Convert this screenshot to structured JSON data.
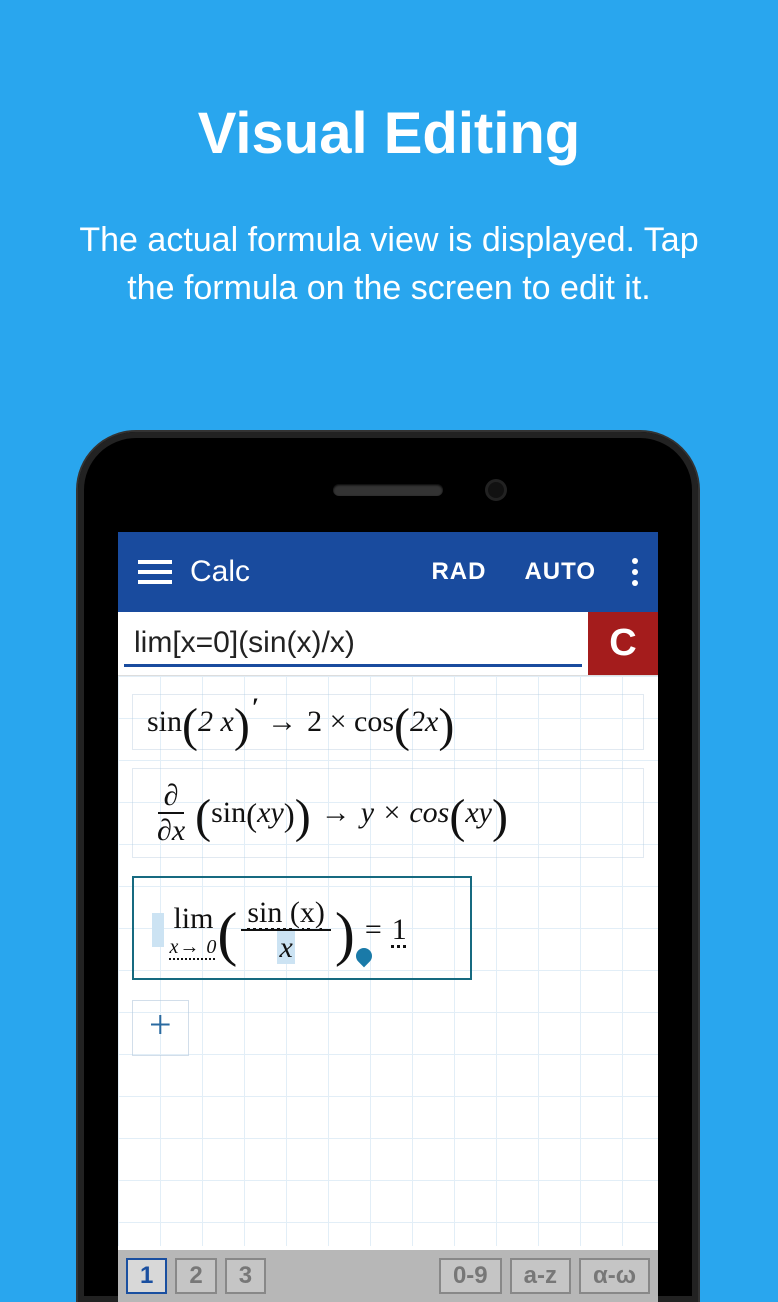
{
  "promo": {
    "title": "Visual Editing",
    "subtitle": "The actual formula view is displayed. Tap the formula on the screen to edit it."
  },
  "appbar": {
    "title": "Calc",
    "angle_mode": "RAD",
    "auto_mode": "AUTO"
  },
  "input": {
    "expression": "lim[x=0](sin(x)/x)",
    "clear_label": "C"
  },
  "formulas": {
    "f1_lhs_prefix": "sin",
    "f1_lhs_inner": "2 x",
    "f1_rhs": "2 × cos",
    "f1_rhs_inner": "2x",
    "f2_d_top": "∂",
    "f2_d_bot": "∂x",
    "f2_lhs": "sin",
    "f2_lhs_inner": "xy",
    "f2_rhs_y": "y × cos",
    "f2_rhs_inner": "xy",
    "f3_lim": "lim",
    "f3_sub": "x→ 0",
    "f3_num": "sin (x)",
    "f3_den": "x",
    "f3_eq": "=",
    "f3_res": "1",
    "add": "+"
  },
  "tabs": {
    "t1": "1",
    "t2": "2",
    "t3": "3",
    "num": "0-9",
    "alpha": "a-z",
    "greek": "α-ω"
  }
}
